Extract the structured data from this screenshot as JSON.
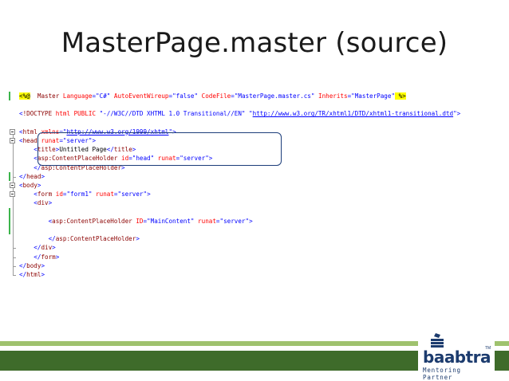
{
  "slide": {
    "title": "MasterPage.master (source)"
  },
  "code": {
    "lines": [
      {
        "parts": [
          [
            "dirhl",
            "<%@"
          ],
          [
            "",
            "  "
          ],
          [
            "tag",
            "Master"
          ],
          [
            "at",
            " Language"
          ],
          [
            "br",
            "="
          ],
          [
            "val",
            "\"C#\""
          ],
          [
            "at",
            " AutoEventWireup"
          ],
          [
            "br",
            "="
          ],
          [
            "val",
            "\"false\""
          ],
          [
            "at",
            " CodeFile"
          ],
          [
            "br",
            "="
          ],
          [
            "val",
            "\"MasterPage.master.cs\""
          ],
          [
            "at",
            " Inherits"
          ],
          [
            "br",
            "="
          ],
          [
            "val",
            "\"MasterPage\""
          ],
          [
            "",
            ""
          ],
          [
            "dirhl2",
            " %>"
          ]
        ]
      },
      {
        "parts": [
          [
            "",
            ""
          ]
        ]
      },
      {
        "parts": [
          [
            "br",
            "<"
          ],
          [
            "tag",
            "!DOCTYPE"
          ],
          [
            "at",
            " html"
          ],
          [
            "at",
            " PUBLIC"
          ],
          [
            "val",
            " \"-//W3C//DTD XHTML 1.0 Transitional//EN\""
          ],
          [
            "val",
            " \""
          ],
          [
            "link",
            "http://www.w3.org/TR/xhtml1/DTD/xhtml1-transitional.dtd"
          ],
          [
            "val",
            "\""
          ],
          [
            "br",
            ">"
          ]
        ]
      },
      {
        "parts": [
          [
            "",
            ""
          ]
        ]
      },
      {
        "parts": [
          [
            "br",
            "<"
          ],
          [
            "tag",
            "html"
          ],
          [
            "at",
            " xmlns"
          ],
          [
            "br",
            "="
          ],
          [
            "val",
            "\""
          ],
          [
            "link",
            "http://www.w3.org/1999/xhtml"
          ],
          [
            "val",
            "\""
          ],
          [
            "br",
            ">"
          ]
        ]
      },
      {
        "parts": [
          [
            "br",
            "<"
          ],
          [
            "tag",
            "head"
          ],
          [
            "at",
            " runat"
          ],
          [
            "br",
            "="
          ],
          [
            "val",
            "\"server\""
          ],
          [
            "br",
            ">"
          ]
        ]
      },
      {
        "parts": [
          [
            "",
            "    "
          ],
          [
            "br",
            "<"
          ],
          [
            "tag",
            "title"
          ],
          [
            "br",
            ">"
          ],
          [
            "",
            "Untitled Page"
          ],
          [
            "br",
            "</"
          ],
          [
            "tag",
            "title"
          ],
          [
            "br",
            ">"
          ]
        ]
      },
      {
        "parts": [
          [
            "",
            "    "
          ],
          [
            "br",
            "<"
          ],
          [
            "tag",
            "asp:ContentPlaceHolder"
          ],
          [
            "at",
            " id"
          ],
          [
            "br",
            "="
          ],
          [
            "val",
            "\"head\""
          ],
          [
            "at",
            " runat"
          ],
          [
            "br",
            "="
          ],
          [
            "val",
            "\"server\""
          ],
          [
            "br",
            ">"
          ]
        ]
      },
      {
        "parts": [
          [
            "",
            "    "
          ],
          [
            "br",
            "</"
          ],
          [
            "tag",
            "asp:ContentPlaceHolder"
          ],
          [
            "br",
            ">"
          ]
        ]
      },
      {
        "parts": [
          [
            "br",
            "</"
          ],
          [
            "tag",
            "head"
          ],
          [
            "br",
            ">"
          ]
        ]
      },
      {
        "parts": [
          [
            "br",
            "<"
          ],
          [
            "tag",
            "body"
          ],
          [
            "br",
            ">"
          ]
        ]
      },
      {
        "parts": [
          [
            "",
            "    "
          ],
          [
            "br",
            "<"
          ],
          [
            "tag",
            "form"
          ],
          [
            "at",
            " id"
          ],
          [
            "br",
            "="
          ],
          [
            "val",
            "\"form1\""
          ],
          [
            "at",
            " runat"
          ],
          [
            "br",
            "="
          ],
          [
            "val",
            "\"server\""
          ],
          [
            "br",
            ">"
          ]
        ]
      },
      {
        "parts": [
          [
            "",
            "    "
          ],
          [
            "br",
            "<"
          ],
          [
            "tag",
            "div"
          ],
          [
            "br",
            ">"
          ]
        ]
      },
      {
        "parts": [
          [
            "",
            ""
          ]
        ]
      },
      {
        "parts": [
          [
            "",
            "        "
          ],
          [
            "br",
            "<"
          ],
          [
            "tag",
            "asp:ContentPlaceHolder"
          ],
          [
            "at",
            " ID"
          ],
          [
            "br",
            "="
          ],
          [
            "val",
            "\"MainContent\""
          ],
          [
            "at",
            " runat"
          ],
          [
            "br",
            "="
          ],
          [
            "val",
            "\"server\""
          ],
          [
            "br",
            ">"
          ]
        ]
      },
      {
        "parts": [
          [
            "",
            ""
          ]
        ]
      },
      {
        "parts": [
          [
            "",
            "        "
          ],
          [
            "br",
            "</"
          ],
          [
            "tag",
            "asp:ContentPlaceHolder"
          ],
          [
            "br",
            ">"
          ]
        ]
      },
      {
        "parts": [
          [
            "",
            "    "
          ],
          [
            "br",
            "</"
          ],
          [
            "tag",
            "div"
          ],
          [
            "br",
            ">"
          ]
        ]
      },
      {
        "parts": [
          [
            "",
            "    "
          ],
          [
            "br",
            "</"
          ],
          [
            "tag",
            "form"
          ],
          [
            "br",
            ">"
          ]
        ]
      },
      {
        "parts": [
          [
            "br",
            "</"
          ],
          [
            "tag",
            "body"
          ],
          [
            "br",
            ">"
          ]
        ]
      },
      {
        "parts": [
          [
            "br",
            "</"
          ],
          [
            "tag",
            "html"
          ],
          [
            "br",
            ">"
          ]
        ]
      }
    ]
  },
  "footer": {
    "logo_word": "baabtra",
    "logo_tm": "TM",
    "logo_tagline": "Mentoring Partner",
    "colors": {
      "band_dark": "#3e6b2a",
      "band_light": "#9fc26e",
      "brand": "#1c3b6e"
    }
  }
}
